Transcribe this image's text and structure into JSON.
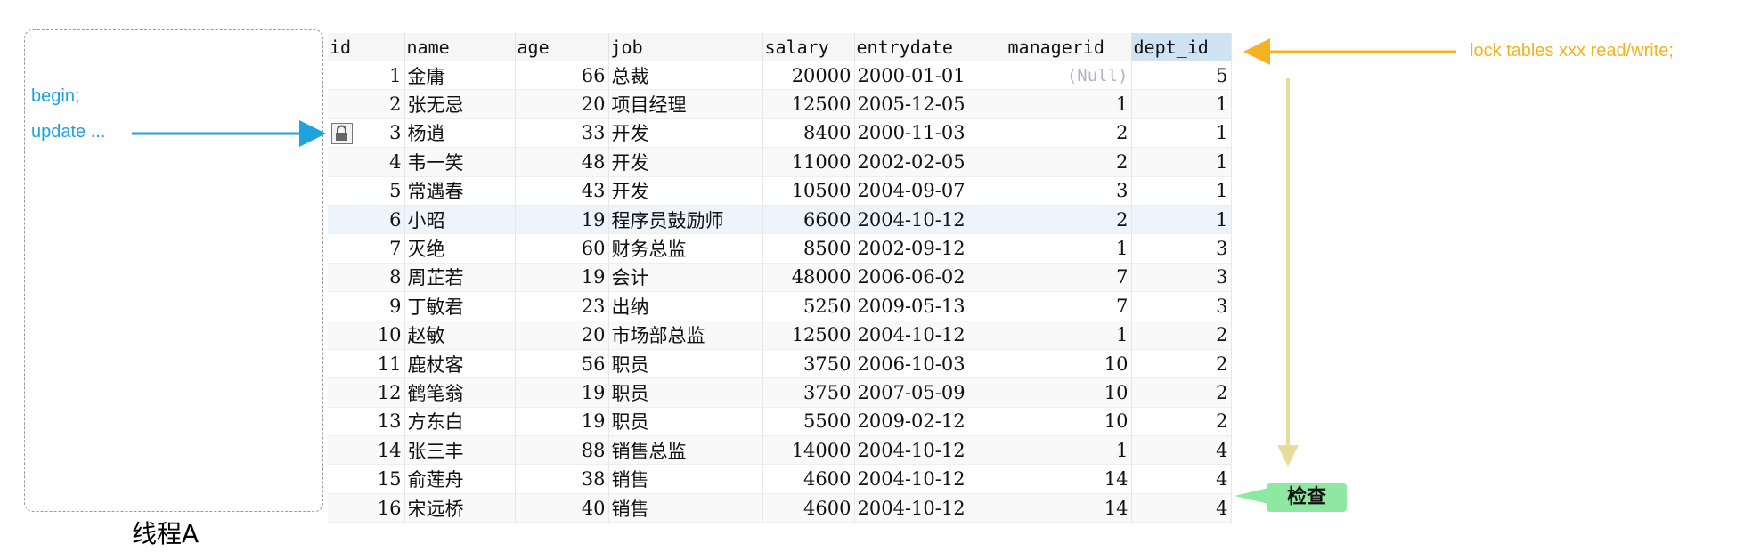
{
  "thread": {
    "label": "线程A",
    "statements": [
      "begin;",
      "update ..."
    ]
  },
  "lock_note": "lock tables xxx read/write;",
  "check_label": "检查",
  "table": {
    "columns": [
      "id",
      "name",
      "age",
      "job",
      "salary",
      "entrydate",
      "managerid",
      "dept_id"
    ],
    "selected_column": "dept_id",
    "locked_row_id": "3",
    "rows": [
      [
        "1",
        "金庸",
        "66",
        "总裁",
        "20000",
        "2000-01-01",
        "(Null)",
        "5"
      ],
      [
        "2",
        "张无忌",
        "20",
        "项目经理",
        "12500",
        "2005-12-05",
        "1",
        "1"
      ],
      [
        "3",
        "杨逍",
        "33",
        "开发",
        "8400",
        "2000-11-03",
        "2",
        "1"
      ],
      [
        "4",
        "韦一笑",
        "48",
        "开发",
        "11000",
        "2002-02-05",
        "2",
        "1"
      ],
      [
        "5",
        "常遇春",
        "43",
        "开发",
        "10500",
        "2004-09-07",
        "3",
        "1"
      ],
      [
        "6",
        "小昭",
        "19",
        "程序员鼓励师",
        "6600",
        "2004-10-12",
        "2",
        "1"
      ],
      [
        "7",
        "灭绝",
        "60",
        "财务总监",
        "8500",
        "2002-09-12",
        "1",
        "3"
      ],
      [
        "8",
        "周芷若",
        "19",
        "会计",
        "48000",
        "2006-06-02",
        "7",
        "3"
      ],
      [
        "9",
        "丁敏君",
        "23",
        "出纳",
        "5250",
        "2009-05-13",
        "7",
        "3"
      ],
      [
        "10",
        "赵敏",
        "20",
        "市场部总监",
        "12500",
        "2004-10-12",
        "1",
        "2"
      ],
      [
        "11",
        "鹿杖客",
        "56",
        "职员",
        "3750",
        "2006-10-03",
        "10",
        "2"
      ],
      [
        "12",
        "鹤笔翁",
        "19",
        "职员",
        "3750",
        "2007-05-09",
        "10",
        "2"
      ],
      [
        "13",
        "方东白",
        "19",
        "职员",
        "5500",
        "2009-02-12",
        "10",
        "2"
      ],
      [
        "14",
        "张三丰",
        "88",
        "销售总监",
        "14000",
        "2004-10-12",
        "1",
        "4"
      ],
      [
        "15",
        "俞莲舟",
        "38",
        "销售",
        "4600",
        "2004-10-12",
        "14",
        "4"
      ],
      [
        "16",
        "宋远桥",
        "40",
        "销售",
        "4600",
        "2004-10-12",
        "14",
        "4"
      ]
    ]
  },
  "colors": {
    "statement": "#1fa3dd",
    "lock_arrow": "#f6b221",
    "scan_arrow": "#e8dc9a",
    "check_badge": "#8fe8a2"
  }
}
